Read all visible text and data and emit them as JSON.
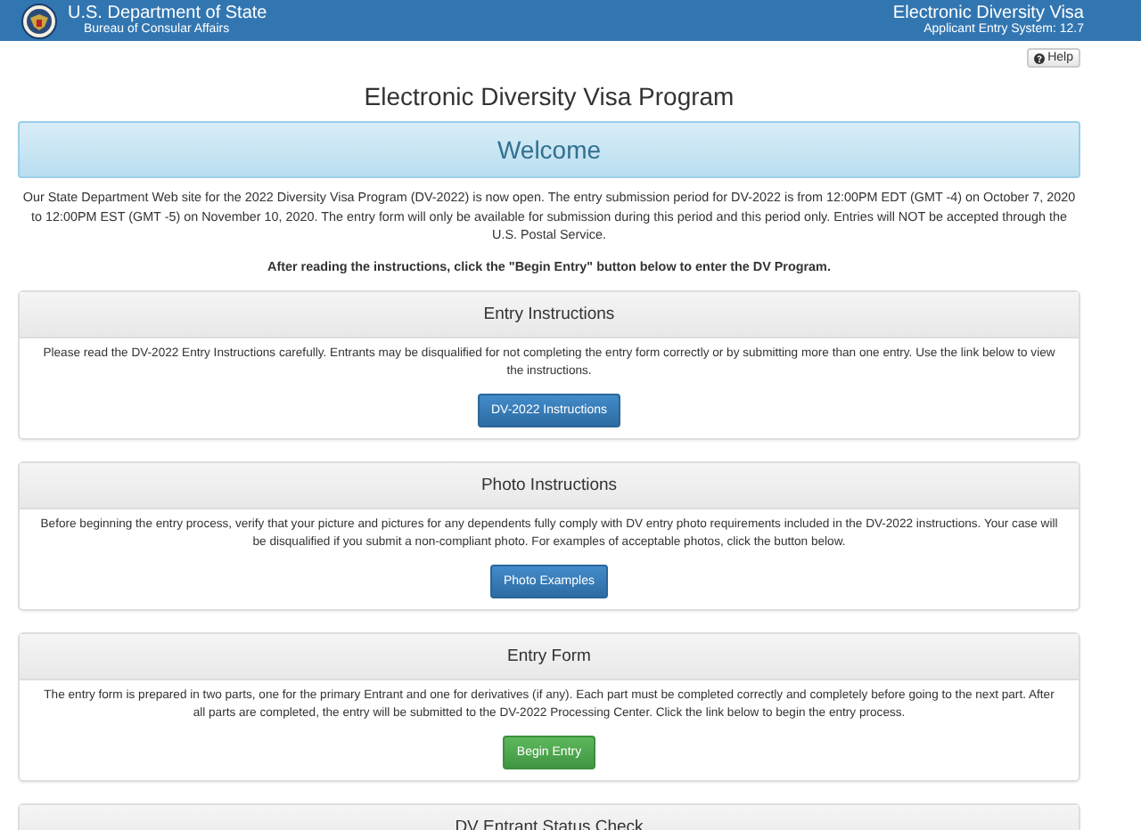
{
  "header": {
    "agency": "U.S. Department of State",
    "bureau": "Bureau of Consular Affairs",
    "system_title": "Electronic Diversity Visa",
    "system_version": "Applicant Entry System: 12.7"
  },
  "help_button": "Help",
  "page_title": "Electronic Diversity Visa Program",
  "welcome": "Welcome",
  "intro": "Our State Department Web site for the 2022 Diversity Visa Program (DV-2022) is now open. The entry submission period for DV-2022 is from 12:00PM EDT (GMT -4) on October 7, 2020 to 12:00PM EST (GMT -5) on November 10, 2020. The entry form will only be available for submission during this period and this period only. Entries will NOT be accepted through the U.S. Postal Service.",
  "instruction": "After reading the instructions, click the \"Begin Entry\" button below to enter the DV Program.",
  "panels": [
    {
      "heading": "Entry Instructions",
      "text": "Please read the DV-2022 Entry Instructions carefully. Entrants may be disqualified for not completing the entry form correctly or by submitting more than one entry. Use the link below to view the instructions.",
      "button": {
        "label": "DV-2022 Instructions",
        "kind": "primary"
      }
    },
    {
      "heading": "Photo Instructions",
      "text": "Before beginning the entry process, verify that your picture and pictures for any dependents fully comply with DV entry photo requirements included in the DV-2022 instructions.  Your case will be disqualified if you submit a non-compliant photo.  For examples of acceptable photos, click the button below.",
      "button": {
        "label": "Photo Examples",
        "kind": "primary"
      }
    },
    {
      "heading": "Entry Form",
      "text": "The entry form is prepared in two parts, one for the primary Entrant and one for derivatives (if any). Each part must be completed correctly and completely before going to the next part. After all parts are completed, the entry will be submitted to the DV-2022 Processing Center. Click the link below to begin the entry process.",
      "button": {
        "label": "Begin Entry",
        "kind": "success"
      }
    },
    {
      "heading": "DV Entrant Status Check"
    }
  ]
}
